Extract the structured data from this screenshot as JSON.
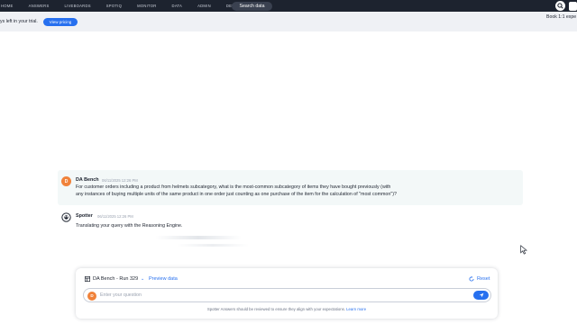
{
  "nav": {
    "items": [
      "HOME",
      "ANSWERS",
      "LIVEBOARDS",
      "SPOTIQ",
      "MONITOR",
      "DATA",
      "ADMIN",
      "DEVELOP"
    ],
    "search_label": "Search data"
  },
  "banner": {
    "text": "ys left in your trial.",
    "pricing_button": "View pricing",
    "right_text": "Book 1:1 expe"
  },
  "user_message": {
    "avatar_initial": "D",
    "name": "DA Bench",
    "timestamp": "06/11/2025 12:26 PM",
    "line1": "For customer orders including a product from helmets subcategory, what is the most-common subcategory of items they have bought previously (with",
    "line2": "any instances of buying multiple units of the same product in one order just counting as one purchase of the item for the calculation of \"most common\")?"
  },
  "spotter_message": {
    "name": "Spotter",
    "timestamp": "06/11/2025 12:26 PM",
    "text": "Translating your query with the Reasoning Engine."
  },
  "composer": {
    "datasource": "DA Bench - Run 329",
    "preview_label": "Preview data",
    "reset_label": "Reset",
    "avatar_initial": "D",
    "input_placeholder": "Enter your question",
    "disclaimer": "Spotter Answers should be reviewed to ensure they align with your expectations.",
    "learn_more": "Learn more"
  },
  "colors": {
    "nav_bg": "#1d232f",
    "accent": "#2770ef",
    "avatar": "#f0823a",
    "message_bg": "#f3f8f8"
  }
}
